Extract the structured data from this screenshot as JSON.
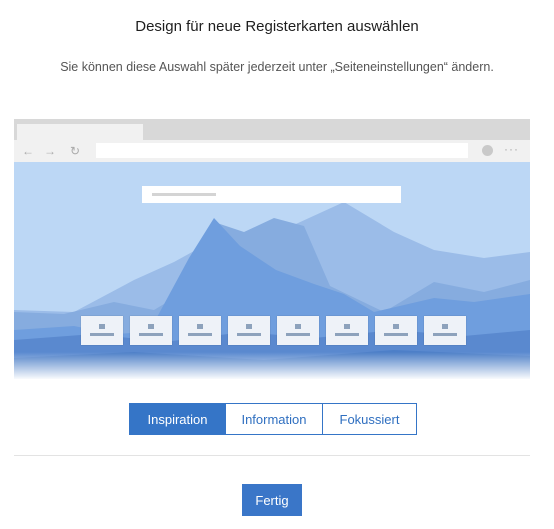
{
  "dialog": {
    "title": "Design für neue Registerkarten auswählen",
    "subtitle": "Sie können diese Auswahl später jederzeit unter „Seiteneinstellungen“ ändern."
  },
  "preview": {
    "nav_icons": [
      "back-arrow-icon",
      "forward-arrow-icon",
      "refresh-icon",
      "more-icon"
    ],
    "quick_link_tile_count": 8,
    "colors": {
      "sky": "#bcd7f5",
      "mountain_light": "#9bbce8",
      "mountain_mid": "#6f9ede",
      "mountain_dark": "#4d7fc8",
      "water": "#5a89cf"
    }
  },
  "layout_options": {
    "selected": "Inspiration",
    "items": [
      {
        "label": "Inspiration"
      },
      {
        "label": "Information"
      },
      {
        "label": "Fokussiert"
      }
    ]
  },
  "footer": {
    "done_label": "Fertig"
  },
  "colors": {
    "accent": "#3575c7"
  }
}
